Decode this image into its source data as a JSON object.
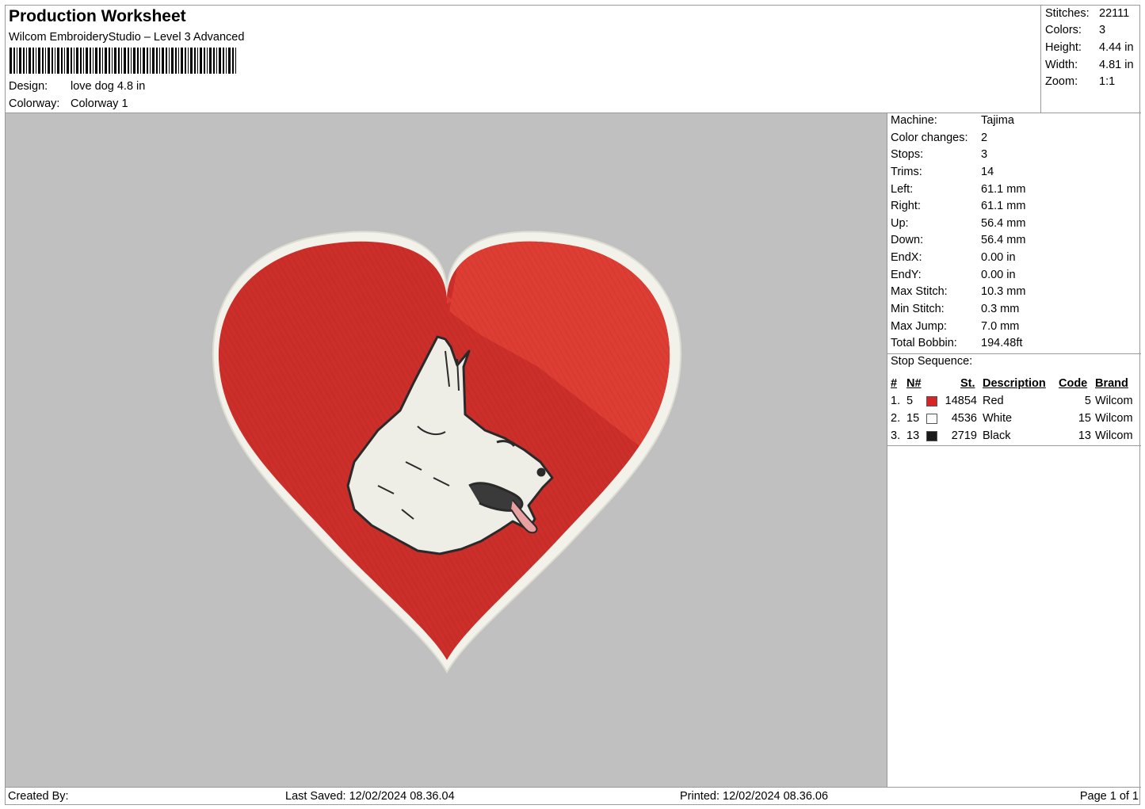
{
  "header": {
    "title": "Production Worksheet",
    "subtitle": "Wilcom EmbroideryStudio – Level 3 Advanced",
    "design_label": "Design:",
    "design_value": "love dog 4.8 in",
    "colorway_label": "Colorway:",
    "colorway_value": "Colorway 1"
  },
  "stats": [
    {
      "label": "Stitches:",
      "value": "22111"
    },
    {
      "label": "Colors:",
      "value": "3"
    },
    {
      "label": "Height:",
      "value": "4.44 in"
    },
    {
      "label": "Width:",
      "value": "4.81 in"
    },
    {
      "label": "Zoom:",
      "value": "1:1"
    }
  ],
  "machine_info": [
    {
      "label": "Machine:",
      "value": "Tajima"
    },
    {
      "label": "Color changes:",
      "value": "2"
    },
    {
      "label": "Stops:",
      "value": "3"
    },
    {
      "label": "Trims:",
      "value": "14"
    },
    {
      "label": "Left:",
      "value": "61.1 mm"
    },
    {
      "label": "Right:",
      "value": "61.1 mm"
    },
    {
      "label": "Up:",
      "value": "56.4 mm"
    },
    {
      "label": "Down:",
      "value": "56.4 mm"
    },
    {
      "label": "EndX:",
      "value": "0.00 in"
    },
    {
      "label": "EndY:",
      "value": "0.00 in"
    },
    {
      "label": "Max Stitch:",
      "value": "10.3 mm"
    },
    {
      "label": "Min Stitch:",
      "value": "0.3 mm"
    },
    {
      "label": "Max Jump:",
      "value": "7.0 mm"
    },
    {
      "label": "Total Bobbin:",
      "value": "194.48ft"
    }
  ],
  "stop_sequence": {
    "title": "Stop Sequence:",
    "columns": [
      "#",
      "N#",
      "St.",
      "Description",
      "Code",
      "Brand"
    ],
    "rows": [
      {
        "num": "1.",
        "needle": "5",
        "stitches": "14854",
        "description": "Red",
        "code": "5",
        "brand": "Wilcom",
        "color": "#d42626"
      },
      {
        "num": "2.",
        "needle": "15",
        "stitches": "4536",
        "description": "White",
        "code": "15",
        "brand": "Wilcom",
        "color": "#ffffff"
      },
      {
        "num": "3.",
        "needle": "13",
        "stitches": "2719",
        "description": "Black",
        "code": "13",
        "brand": "Wilcom",
        "color": "#1a1a1a"
      }
    ]
  },
  "footer": {
    "created_by": "Created By:",
    "last_saved": "Last Saved: 12/02/2024 08.36.04",
    "printed": "Printed: 12/02/2024 08.36.06",
    "page": "Page 1 of 1"
  },
  "colors": {
    "preview_bg": "#c0c0c0",
    "heart_fill": "#cc2e2a",
    "heart_highlight": "#dd3d33",
    "border_white": "#f2f2ea",
    "outline_black": "#2a2a2a"
  }
}
